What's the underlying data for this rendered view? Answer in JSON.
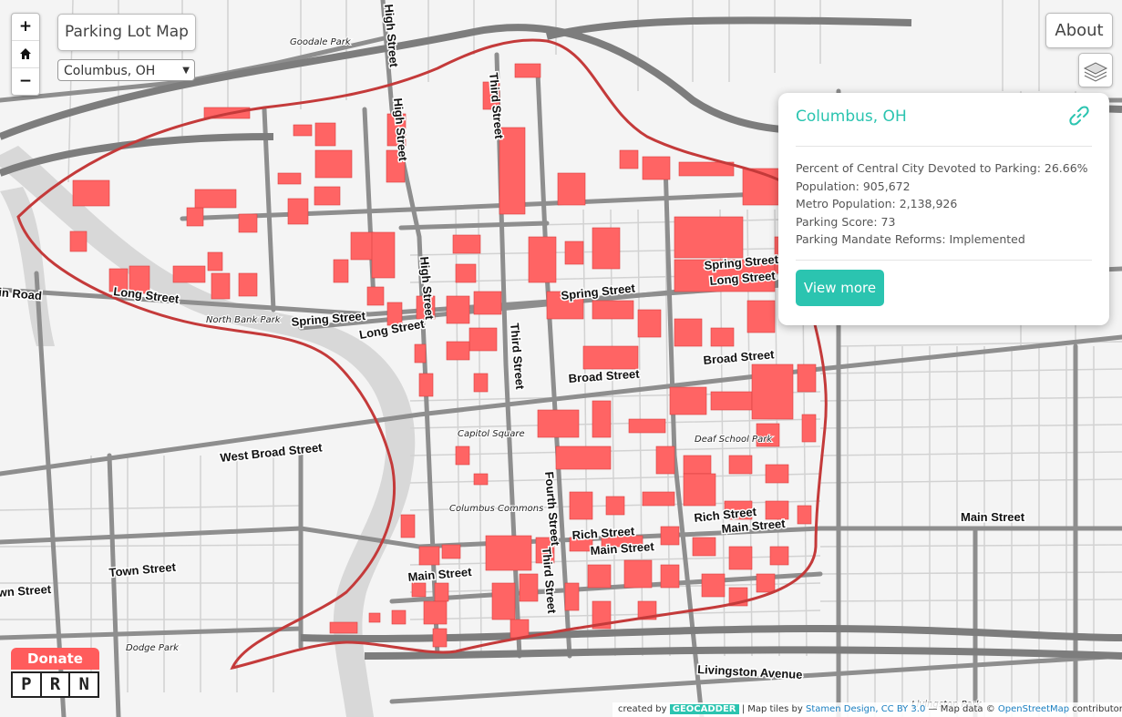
{
  "app": {
    "title": "Parking Lot Map",
    "city_selected": "Columbus, OH",
    "about_label": "About"
  },
  "zoom": {
    "in_label": "+",
    "home_icon": "home-icon",
    "out_label": "−"
  },
  "popup": {
    "city": "Columbus, OH",
    "stats": [
      "Percent of Central City Devoted to Parking: 26.66%",
      "Population: 905,672",
      "Metro Population: 2,138,926",
      "Parking Score: 73",
      "Parking Mandate Reforms: Implemented"
    ],
    "view_more_label": "View more"
  },
  "map_labels": {
    "streets": {
      "high_street_1": "High Street",
      "high_street_2": "High Street",
      "high_street_3": "High Street",
      "third_street_1": "Third Street",
      "third_street_2": "Third Street",
      "third_street_3": "Third Street",
      "fourth_street": "Fourth Street",
      "long_street_1": "Long Street",
      "long_street_2": "Long Street",
      "long_street_3": "Long Street",
      "spring_street_1": "Spring Street",
      "spring_street_2": "Spring Street",
      "spring_street_3": "Spring Street",
      "broad_street_1": "Broad Street",
      "broad_street_2": "Broad Street",
      "west_broad": "West Broad Street",
      "main_street_1": "Main Street",
      "main_street_2": "Main Street",
      "main_street_3": "Main Street",
      "main_street_4": "Main Street",
      "rich_street_1": "Rich Street",
      "rich_street_2": "Rich Street",
      "town_street": "Town Street",
      "livingston": "Livingston Avenue",
      "in_road": "in Road",
      "wn_street": "wn Street"
    },
    "parks": {
      "goodale": "Goodale Park",
      "north_bank": "North Bank Park",
      "capitol_square": "Capitol Square",
      "deaf_school": "Deaf School Park",
      "columbus_commons": "Columbus Commons",
      "dodge": "Dodge Park",
      "livingston_park": "Livingston Park"
    }
  },
  "donate": {
    "label": "Donate",
    "prn_letters": [
      "P",
      "R",
      "N"
    ]
  },
  "attribution": {
    "created_by": "created by",
    "geocadder": "GEOCADDER",
    "tiles": "| Map tiles by",
    "stamen": "Stamen Design, CC BY 3.0",
    "map_data": "— Map data ©",
    "osm": "OpenStreetMap",
    "contributors": "contributors"
  },
  "colors": {
    "parking_fill": "#ff6464",
    "boundary": "#c43a3a",
    "accent": "#2bc4b0",
    "donate": "#ff5c5c"
  }
}
